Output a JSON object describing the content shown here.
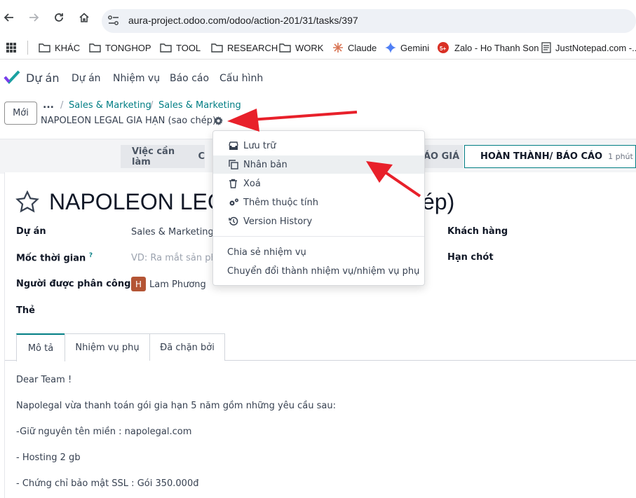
{
  "browser": {
    "url": "aura-project.odoo.com/odoo/action-201/31/tasks/397",
    "bookmarks": [
      "KHÁC",
      "TONGHOP",
      "TOOL",
      "RESEARCH",
      "WORK",
      "Claude",
      "Gemini",
      "Zalo - Ho Thanh Son",
      "JustNotepad.com -..."
    ],
    "zalo_badge": "5+"
  },
  "app": {
    "name": "Dự án",
    "menu": [
      "Dự án",
      "Nhiệm vụ",
      "Báo cáo",
      "Cấu hình"
    ]
  },
  "control": {
    "new_label": "Mới",
    "breadcrumb_more": "...",
    "breadcrumb": [
      "Sales & Marketing",
      "Sales & Marketing"
    ],
    "record_title": "NAPOLEON LEGAL GIA HẠN (sao chép)"
  },
  "stages": {
    "first": "Việc cần làm",
    "partial_prefix": "C",
    "second": "ÁO GIÁ",
    "active": "HOÀN THÀNH/ BÁO CÁO",
    "active_duration": "1 phút"
  },
  "form": {
    "task_name_left": "NAPOLEON LEG",
    "task_name_right": "ép)",
    "labels": {
      "project": "Dự án",
      "milestone": "Mốc thời gian",
      "milestone_help": "?",
      "assignee": "Người được phân công",
      "tags": "Thẻ",
      "customer": "Khách hàng",
      "deadline": "Hạn chót"
    },
    "project_value": "Sales & Marketing",
    "milestone_placeholder": "VD: Ra mắt sản phẩ",
    "assignee_initial": "H",
    "assignee_name": "Lam Phương"
  },
  "tabs": [
    "Mô tả",
    "Nhiệm vụ phụ",
    "Đã chặn bởi"
  ],
  "description": [
    "Dear Team !",
    "Napolegal vừa thanh toán gói gia hạn 5 năm gồm những yêu cầu sau:",
    "-Giữ nguyên tên miền : napolegal.com",
    "- Hosting 2 gb",
    "- Chứng chỉ bảo mật SSL : Gói 350.000đ"
  ],
  "dropdown": {
    "archive": "Lưu trữ",
    "duplicate": "Nhân bản",
    "delete": "Xoá",
    "add_property": "Thêm thuộc tính",
    "version_history": "Version History",
    "share": "Chia sẻ nhiệm vụ",
    "convert": "Chuyển đổi thành nhiệm vụ/nhiệm vụ phụ"
  },
  "colors": {
    "accent": "#017e84",
    "arrow": "#e8202a",
    "avatar": "#b45535"
  }
}
